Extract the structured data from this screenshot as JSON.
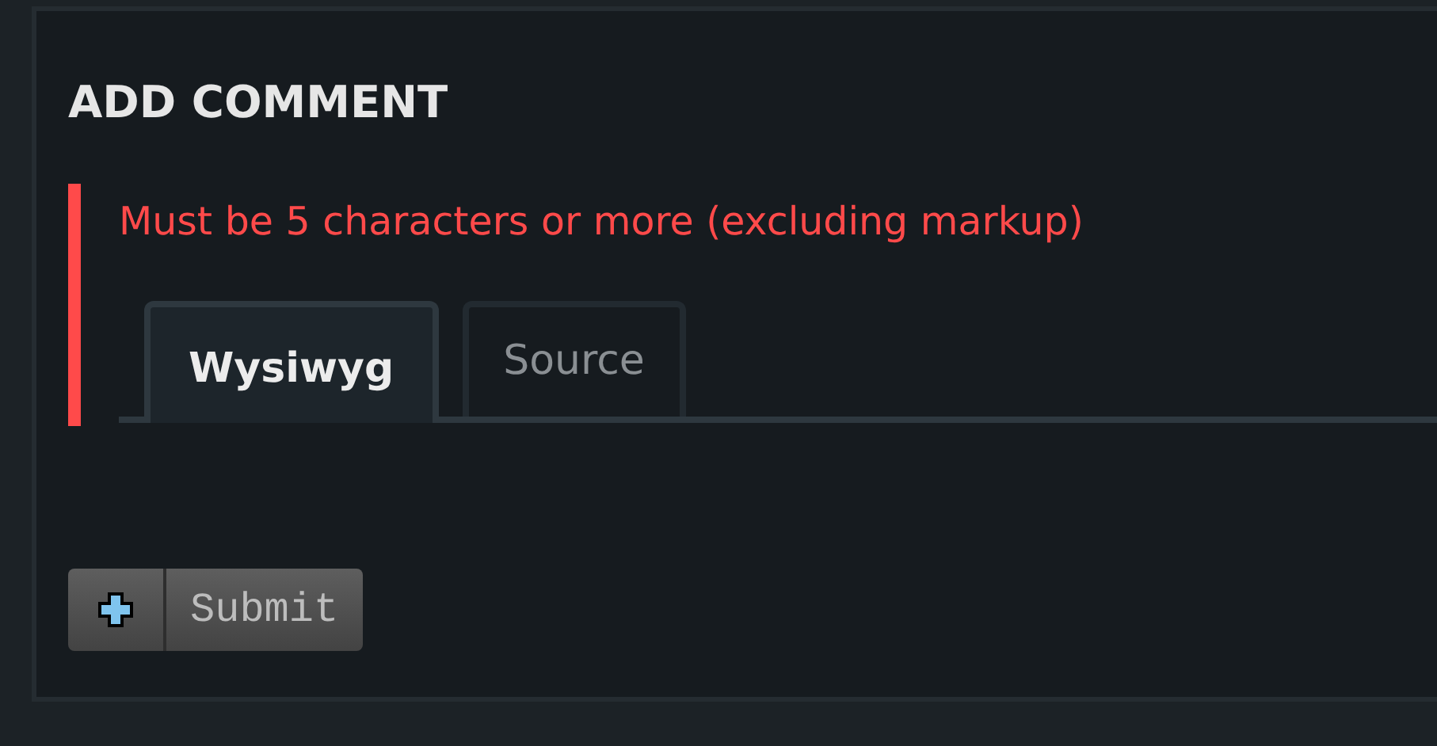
{
  "heading": "ADD COMMENT",
  "error": "Must be 5 characters or more (excluding markup)",
  "tabs": [
    {
      "label": "Wysiwyg",
      "selected": true
    },
    {
      "label": "Source",
      "selected": false
    }
  ],
  "submit_button": {
    "label": "Submit"
  }
}
